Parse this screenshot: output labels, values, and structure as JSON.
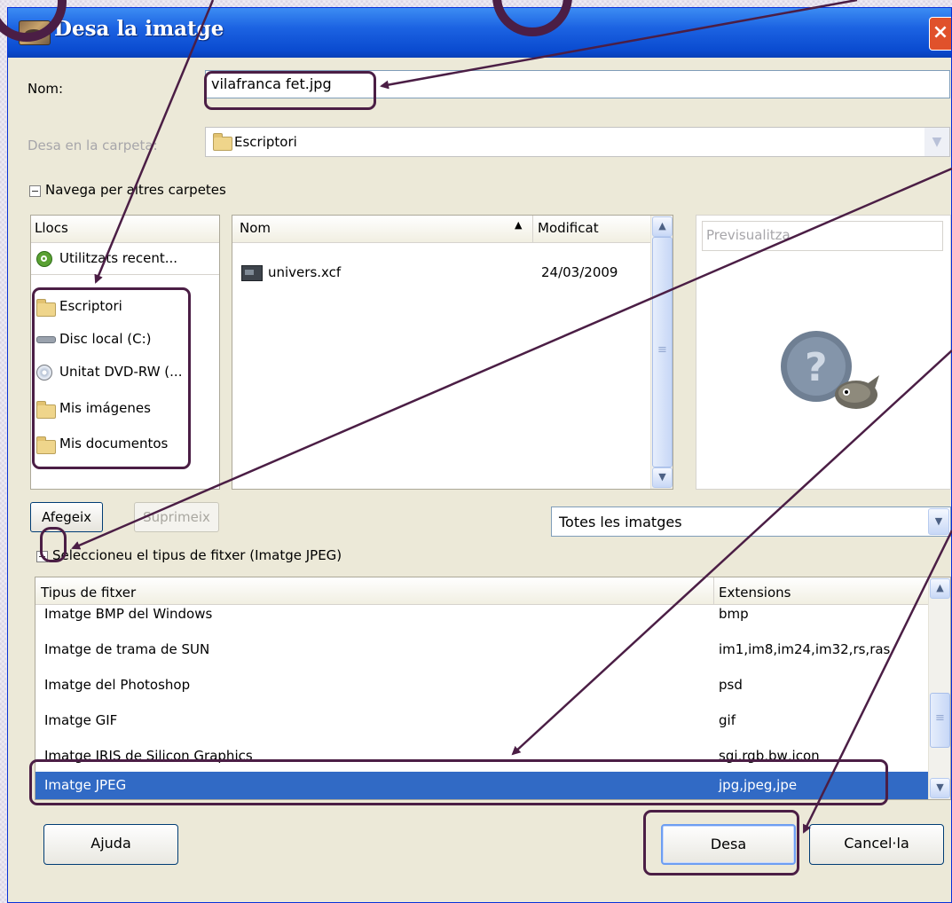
{
  "window": {
    "title": "Desa la imatge",
    "close_label": "×"
  },
  "form": {
    "name_label": "Nom:",
    "name_value": "vilafranca fet.jpg",
    "save_in_label": "Desa en la carpeta:",
    "save_in_value": "Escriptori",
    "browse_label": "Navega per altres carpetes"
  },
  "places": {
    "header": "Llocs",
    "items": [
      {
        "label": "Utilitzats recent...",
        "icon": "recent-icon"
      },
      {
        "label": "Escriptori",
        "icon": "folder-icon"
      },
      {
        "label": "Disc local (C:)",
        "icon": "disk-icon"
      },
      {
        "label": "Unitat DVD-RW (...",
        "icon": "dvd-icon"
      },
      {
        "label": "Mis imágenes",
        "icon": "folder-icon"
      },
      {
        "label": "Mis documentos",
        "icon": "folder-icon"
      }
    ]
  },
  "files": {
    "columns": {
      "name": "Nom",
      "modified": "Modificat",
      "sort_indicator": "▲"
    },
    "rows": [
      {
        "name": "univers.xcf",
        "modified": "24/03/2009",
        "icon": "xcf-file-icon"
      }
    ]
  },
  "preview": {
    "label": "Previsualitza"
  },
  "buttons": {
    "add": "Afegeix",
    "remove": "Suprimeix",
    "help": "Ajuda",
    "save": "Desa",
    "cancel": "Cancel·la"
  },
  "filter": {
    "value": "Totes les imatges"
  },
  "filetype": {
    "expander_label": "Seleccioneu el tipus de fitxer (Imatge JPEG)",
    "columns": {
      "type": "Tipus de fitxer",
      "extensions": "Extensions"
    },
    "rows": [
      {
        "type": "Imatge BMP del Windows",
        "ext": "bmp"
      },
      {
        "type": "Imatge de trama de SUN",
        "ext": "im1,im8,im24,im32,rs,ras"
      },
      {
        "type": "Imatge del Photoshop",
        "ext": "psd"
      },
      {
        "type": "Imatge GIF",
        "ext": "gif"
      },
      {
        "type": "Imatge IRIS de Silicon Graphics",
        "ext": "sgi,rgb,bw,icon"
      },
      {
        "type": "Imatge JPEG",
        "ext": "jpg,jpeg,jpe",
        "selected": true
      }
    ]
  },
  "colors": {
    "annotation": "#4b1e45",
    "titlebar": "#0a4bd0",
    "selection": "#316ac5",
    "dialog_bg": "#ece9d8"
  }
}
